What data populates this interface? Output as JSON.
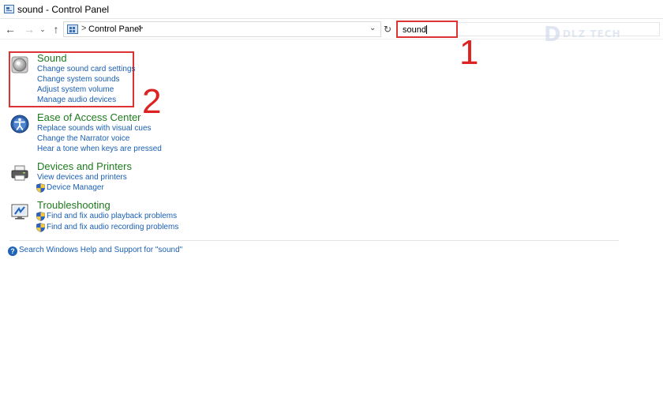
{
  "window": {
    "title": "sound - Control Panel"
  },
  "nav": {
    "back": "←",
    "forward": "→",
    "recent": "⌄",
    "up": "↑",
    "refresh": "↻"
  },
  "address": {
    "separator": ">",
    "crumbs": [
      "Control Panel"
    ],
    "dropdown": "⌄"
  },
  "search": {
    "value": "sound"
  },
  "watermark": {
    "mark": "D",
    "text": "DLZ TECH"
  },
  "annotations": {
    "one": "1",
    "two": "2"
  },
  "results": [
    {
      "heading": "Sound",
      "icon": "speaker-icon",
      "links": [
        "Change sound card settings",
        "Change system sounds",
        "Adjust system volume",
        "Manage audio devices"
      ]
    },
    {
      "heading": "Ease of Access Center",
      "icon": "ease-of-access-icon",
      "links": [
        "Replace sounds with visual cues",
        "Change the Narrator voice",
        "Hear a tone when keys are pressed"
      ]
    },
    {
      "heading": "Devices and Printers",
      "icon": "printer-icon",
      "links": [
        "View devices and printers",
        "Device Manager"
      ],
      "shielded": [
        false,
        true
      ]
    },
    {
      "heading": "Troubleshooting",
      "icon": "troubleshooting-icon",
      "links": [
        "Find and fix audio playback problems",
        "Find and fix audio recording problems"
      ],
      "shielded": [
        true,
        true
      ]
    }
  ],
  "help": {
    "icon": "?",
    "link": "Search Windows Help and Support for \"sound\""
  },
  "colors": {
    "heading": "#1e7b1e",
    "link": "#1a5fb4",
    "annotation": "#d33333"
  }
}
